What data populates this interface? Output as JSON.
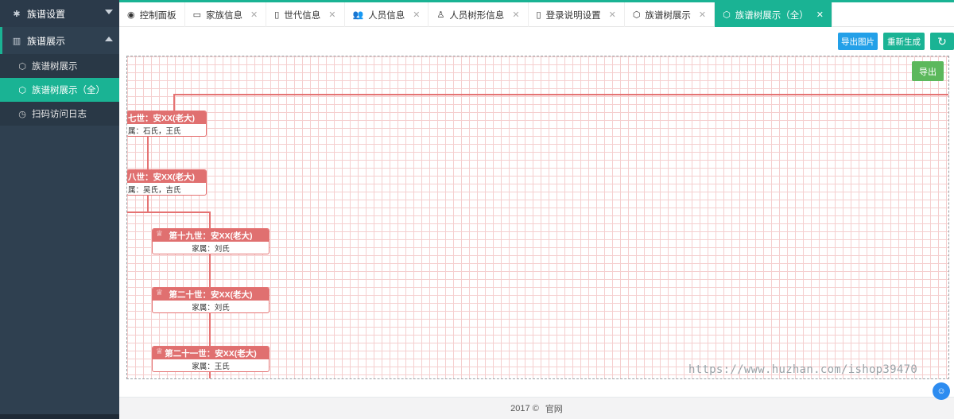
{
  "sidebar": {
    "group1": {
      "icon": "gear-icon",
      "label": "族谱设置"
    },
    "group2": {
      "icon": "book-icon",
      "label": "族谱展示"
    },
    "items": [
      {
        "icon": "cube-icon",
        "label": "族谱树展示"
      },
      {
        "icon": "cube-icon",
        "label": "族谱树展示（全）",
        "active": true
      },
      {
        "icon": "clock-icon",
        "label": "扫码访问日志"
      }
    ]
  },
  "tabs": [
    {
      "icon": "dashboard-icon",
      "label": "控制面板",
      "closable": false
    },
    {
      "icon": "window-icon",
      "label": "家族信息",
      "closable": true
    },
    {
      "icon": "file-icon",
      "label": "世代信息",
      "closable": true
    },
    {
      "icon": "users-icon",
      "label": "人员信息",
      "closable": true
    },
    {
      "icon": "user-icon",
      "label": "人员树形信息",
      "closable": true
    },
    {
      "icon": "file-icon",
      "label": "登录说明设置",
      "closable": true
    },
    {
      "icon": "cube-icon",
      "label": "族谱树展示",
      "closable": true
    },
    {
      "icon": "cube-icon",
      "label": "族谱树展示（全）",
      "closable": true,
      "active": true
    }
  ],
  "toolbar": {
    "export_image": "导出图片",
    "regenerate": "重新生成",
    "refresh_icon": "refresh-icon"
  },
  "tree": {
    "export": "导出",
    "nodes": [
      {
        "title": "七世：安XX(老大)",
        "spouse": "属：石氏，王氏"
      },
      {
        "title": "八世：安XX(老大)",
        "spouse": "属：吴氏，吉氏"
      },
      {
        "title": "第十九世：安XX(老大)",
        "spouse": "家属：刘氏"
      },
      {
        "title": "第二十世：安XX(老大)",
        "spouse": "家属：刘氏"
      },
      {
        "title": "第二十一世：安XX(老大)",
        "spouse": "家属：王氏"
      }
    ]
  },
  "watermark": "https://www.huzhan.com/ishop39470",
  "footer": {
    "year": "2017 ©",
    "link": "官网"
  },
  "colors": {
    "accent": "#1ab394",
    "sidebar": "#2f4050",
    "node": "#e07070",
    "blue": "#23a0e8",
    "green": "#5cb85c"
  }
}
